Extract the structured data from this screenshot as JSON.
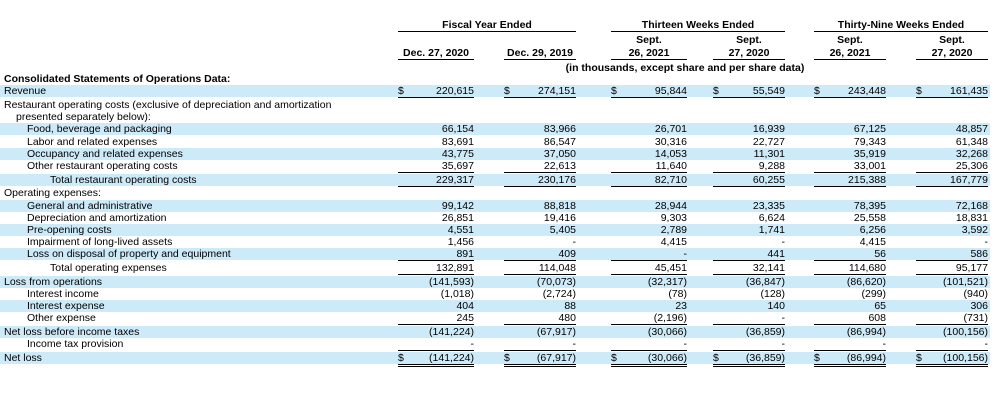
{
  "header": {
    "group_fiscal": "Fiscal Year Ended",
    "group_thirteen": "Thirteen Weeks Ended",
    "group_thirtynine": "Thirty-Nine Weeks Ended",
    "cols": [
      {
        "line1": "",
        "line2": "Dec. 27, 2020"
      },
      {
        "line1": "",
        "line2": "Dec. 29, 2019"
      },
      {
        "line1": "Sept.",
        "line2": "26, 2021"
      },
      {
        "line1": "Sept.",
        "line2": "27, 2020"
      },
      {
        "line1": "Sept.",
        "line2": "26, 2021"
      },
      {
        "line1": "Sept.",
        "line2": "27, 2020"
      }
    ],
    "units_note": "(in thousands, except share and per share data)"
  },
  "table": {
    "rows": [
      {
        "label": "Consolidated Statements of Operations Data:",
        "bold": true,
        "indent": 0,
        "shade": false,
        "values": []
      },
      {
        "label": "Revenue",
        "indent": 0,
        "shade": true,
        "dollar": true,
        "underline": "single",
        "values": [
          "220,615",
          "274,151",
          "95,844",
          "55,549",
          "243,448",
          "161,435"
        ]
      },
      {
        "label": "Restaurant operating costs (exclusive of depreciation and amortization",
        "label2": "presented separately below):",
        "indent": 0,
        "shade": false,
        "values": []
      },
      {
        "label": "Food, beverage and packaging",
        "indent": 1,
        "shade": true,
        "values": [
          "66,154",
          "83,966",
          "26,701",
          "16,939",
          "67,125",
          "48,857"
        ]
      },
      {
        "label": "Labor and related expenses",
        "indent": 1,
        "shade": false,
        "values": [
          "83,691",
          "86,547",
          "30,316",
          "22,727",
          "79,343",
          "61,348"
        ]
      },
      {
        "label": "Occupancy and related expenses",
        "indent": 1,
        "shade": true,
        "values": [
          "43,775",
          "37,050",
          "14,053",
          "11,301",
          "35,919",
          "32,268"
        ]
      },
      {
        "label": "Other restaurant operating costs",
        "indent": 1,
        "shade": false,
        "underline": "single",
        "values": [
          "35,697",
          "22,613",
          "11,640",
          "9,288",
          "33,001",
          "25,306"
        ]
      },
      {
        "label": "Total restaurant operating costs",
        "indent": 2,
        "shade": true,
        "underline": "single",
        "values": [
          "229,317",
          "230,176",
          "82,710",
          "60,255",
          "215,388",
          "167,779"
        ]
      },
      {
        "label": "Operating expenses:",
        "indent": 0,
        "shade": false,
        "values": []
      },
      {
        "label": "General and administrative",
        "indent": 1,
        "shade": true,
        "values": [
          "99,142",
          "88,818",
          "28,944",
          "23,335",
          "78,395",
          "72,168"
        ]
      },
      {
        "label": "Depreciation and amortization",
        "indent": 1,
        "shade": false,
        "values": [
          "26,851",
          "19,416",
          "9,303",
          "6,624",
          "25,558",
          "18,831"
        ]
      },
      {
        "label": "Pre-opening costs",
        "indent": 1,
        "shade": true,
        "values": [
          "4,551",
          "5,405",
          "2,789",
          "1,741",
          "6,256",
          "3,592"
        ]
      },
      {
        "label": "Impairment of long-lived assets",
        "indent": 1,
        "shade": false,
        "values": [
          "1,456",
          "-",
          "4,415",
          "-",
          "4,415",
          "-"
        ]
      },
      {
        "label": "Loss on disposal of property and equipment",
        "indent": 1,
        "shade": true,
        "underline": "single",
        "values": [
          "891",
          "409",
          "-",
          "441",
          "56",
          "586"
        ]
      },
      {
        "label": "Total operating expenses",
        "indent": 2,
        "shade": false,
        "underline": "single",
        "values": [
          "132,891",
          "114,048",
          "45,451",
          "32,141",
          "114,680",
          "95,177"
        ]
      },
      {
        "label": "Loss from operations",
        "indent": 0,
        "shade": true,
        "values": [
          "(141,593)",
          "(70,073)",
          "(32,317)",
          "(36,847)",
          "(86,620)",
          "(101,521)"
        ]
      },
      {
        "label": "Interest income",
        "indent": 1,
        "shade": false,
        "values": [
          "(1,018)",
          "(2,724)",
          "(78)",
          "(128)",
          "(299)",
          "(940)"
        ]
      },
      {
        "label": "Interest expense",
        "indent": 1,
        "shade": true,
        "values": [
          "404",
          "88",
          "23",
          "140",
          "65",
          "306"
        ]
      },
      {
        "label": "Other expense",
        "indent": 1,
        "shade": false,
        "underline": "single",
        "values": [
          "245",
          "480",
          "(2,196)",
          "-",
          "608",
          "(731)"
        ]
      },
      {
        "label": "Net loss before income taxes",
        "indent": 0,
        "shade": true,
        "values": [
          "(141,224)",
          "(67,917)",
          "(30,066)",
          "(36,859)",
          "(86,994)",
          "(100,156)"
        ]
      },
      {
        "label": "Income tax provision",
        "indent": 1,
        "shade": false,
        "underline": "single",
        "values": [
          "-",
          "-",
          "-",
          "-",
          "-",
          "-"
        ]
      },
      {
        "label": "Net loss",
        "indent": 0,
        "shade": true,
        "dollar": true,
        "underline": "double",
        "values": [
          "(141,224)",
          "(67,917)",
          "(30,066)",
          "(36,859)",
          "(86,994)",
          "(100,156)"
        ]
      }
    ],
    "currency_symbol": "$"
  }
}
